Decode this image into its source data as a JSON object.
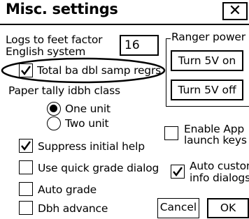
{
  "window": {
    "title": "Misc. settings",
    "close_glyph": "✕"
  },
  "logs_factor": {
    "label_line1": "Logs to feet factor",
    "label_line2": "English system",
    "value": "16"
  },
  "total_ba": {
    "label": "Total ba dbl samp regrs",
    "checked": true
  },
  "ranger_power": {
    "title": "Ranger power –",
    "on_label": "Turn 5V on",
    "off_label": "Turn 5V off"
  },
  "paper_tally": {
    "label": "Paper tally idbh class",
    "options": [
      {
        "label": "One unit",
        "selected": true
      },
      {
        "label": "Two unit",
        "selected": false
      }
    ]
  },
  "enable_app": {
    "line1": "Enable App",
    "line2": "launch keys",
    "checked": false
  },
  "suppress_help": {
    "label": "Suppress initial help",
    "checked": true
  },
  "quick_grade": {
    "label": "Use quick grade dialog",
    "checked": false
  },
  "auto_custom": {
    "line1": "Auto custom",
    "line2": "info dialogs",
    "checked": true
  },
  "auto_grade": {
    "label": "Auto grade",
    "checked": false
  },
  "dbh_advance": {
    "label": "Dbh advance",
    "checked": false
  },
  "footer": {
    "cancel_label": "Cancel",
    "ok_label": "OK"
  }
}
